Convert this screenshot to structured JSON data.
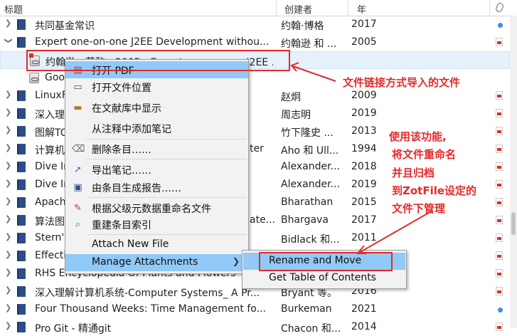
{
  "header": {
    "title_col": "标题",
    "creator_col": "创建者",
    "year_col": "年"
  },
  "rows": [
    {
      "title": "共同基金常识",
      "creator": "约翰·博格",
      "year": "2017",
      "marker": "dot"
    },
    {
      "title": "Expert one-on-one J2EE Development withou...",
      "creator": "约翰逊 和 ...",
      "year": "2005",
      "marker": "pdf"
    },
    {
      "title": "约翰逊 - 英酌 - 2005 - Expert one-on-one J2EE ...",
      "creator": "",
      "year": "",
      "marker": ""
    },
    {
      "title": "Goo",
      "creator": "",
      "year": "",
      "marker": ""
    },
    {
      "title": "LinuxF",
      "creator": "赵炯",
      "year": "2009",
      "marker": "pdf"
    },
    {
      "title": "深入理",
      "creator": "周志明",
      "year": "2019",
      "marker": "pdf"
    },
    {
      "title": "图解TC",
      "creator": "竹下隆史 ...",
      "year": "2013",
      "marker": "pdf"
    },
    {
      "title": "计算机",
      "creator": "Aho 和 Ull...",
      "year": "1994",
      "marker": "pdf"
    },
    {
      "title": "Dive In",
      "creator": "Alexander...",
      "year": "2018",
      "marker": "pdf"
    },
    {
      "title": "Dive In",
      "creator": "Alexander...",
      "year": "2019",
      "marker": "pdf"
    },
    {
      "title": "Apach",
      "creator": "Bharathan",
      "year": "2015",
      "marker": "pdf"
    },
    {
      "title": "算法图",
      "creator": "Bhargava",
      "year": "2017",
      "marker": "pdf"
    },
    {
      "title": "Stern'",
      "creator": "Bidlack 和...",
      "year": "2011",
      "marker": "pdf"
    },
    {
      "title": "Effecti",
      "creator": "",
      "year": "",
      "marker": "pdf"
    },
    {
      "title": "RHS Encyclopedia Of Plants and Flowers",
      "creator": "",
      "year": "",
      "marker": "pdf"
    },
    {
      "title": "深入理解计算机系统-Computer Systems_ A Pr...",
      "creator": "Bryant 等。",
      "year": "2016",
      "marker": "pdf"
    },
    {
      "title": "Four Thousand Weeks: Time Management fo...",
      "creator": "Burkeman",
      "year": "2021",
      "marker": "dot"
    },
    {
      "title": "Pro Git - 精通git",
      "creator": "Chacon 和...",
      "year": "2014",
      "marker": "pdf"
    }
  ],
  "partial_text": {
    "row_ter": "ter",
    "row_ate": "ate..."
  },
  "context_menu": {
    "items": [
      {
        "label": "打开 PDF",
        "icon": "pdf-icon"
      },
      {
        "label": "打开文件位置",
        "icon": "folder-icon"
      },
      {
        "label": "在文献库中显示",
        "icon": "library-icon"
      },
      {
        "label": "从注释中添加笔记",
        "icon": ""
      },
      {
        "label": "删除条目……",
        "icon": "trash-icon"
      },
      {
        "label": "导出笔记……",
        "icon": "export-arrow-icon"
      },
      {
        "label": "由条目生成报告……",
        "icon": "report-icon"
      },
      {
        "label": "根据父级元数据重命名文件",
        "icon": "rename-icon"
      },
      {
        "label": "重建条目索引",
        "icon": "index-icon"
      },
      {
        "label": "Attach New File",
        "icon": ""
      },
      {
        "label": "Manage Attachments",
        "icon": ""
      }
    ]
  },
  "submenu": {
    "rename_move": "Rename and Move",
    "table_of_contents": "Get Table of Contents"
  },
  "annotations": {
    "linked_file": "文件链接方式导入的文件",
    "zotfile_line1": "使用该功能,",
    "zotfile_line2": "将文件重命名",
    "zotfile_line3": "并且归档",
    "zotfile_line4": "到ZotFile设定的",
    "zotfile_line5": "文件下管理"
  },
  "colors": {
    "annotation": "#e32a2a",
    "highlight": "#91c9f7",
    "selected_row": "#e5f1fb",
    "book": "#2c4d86",
    "status_dot": "#3f8fe0"
  }
}
